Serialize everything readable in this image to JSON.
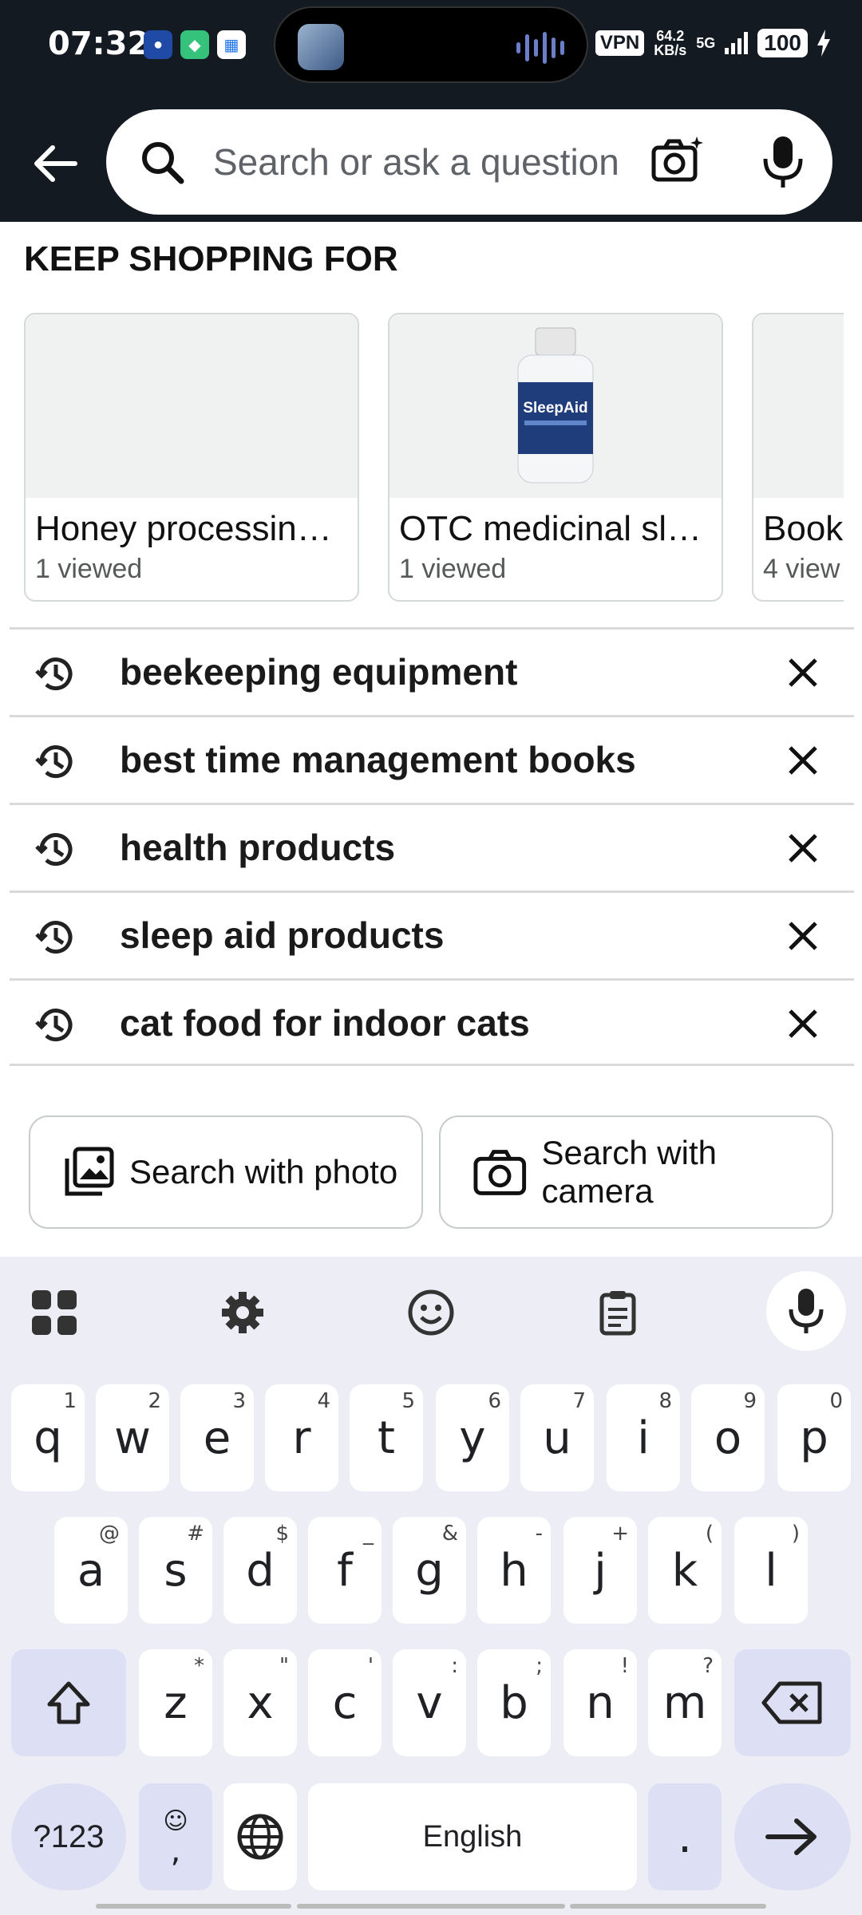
{
  "status_bar": {
    "time": "07:32",
    "vpn": "VPN",
    "net_speed_value": "64.2",
    "net_speed_unit": "KB/s",
    "network": "5G",
    "battery": "100"
  },
  "search": {
    "placeholder": "Search or ask a question"
  },
  "keep_shopping": {
    "title": "KEEP SHOPPING FOR",
    "cards": [
      {
        "name": "Honey processin…",
        "sub": "1 viewed"
      },
      {
        "name": "OTC medicinal sl…",
        "sub": "1 viewed"
      },
      {
        "name": "Book",
        "sub": "4 view"
      }
    ],
    "product_label": "SleepAid"
  },
  "history": [
    "beekeeping equipment",
    "best time management books",
    "health products",
    "sleep aid products",
    "cat food for indoor cats"
  ],
  "buttons": {
    "photo": "Search with photo",
    "camera": "Search with camera"
  },
  "keyboard": {
    "row1": [
      [
        "q",
        "1"
      ],
      [
        "w",
        "2"
      ],
      [
        "e",
        "3"
      ],
      [
        "r",
        "4"
      ],
      [
        "t",
        "5"
      ],
      [
        "y",
        "6"
      ],
      [
        "u",
        "7"
      ],
      [
        "i",
        "8"
      ],
      [
        "o",
        "9"
      ],
      [
        "p",
        "0"
      ]
    ],
    "row2": [
      [
        "a",
        "@"
      ],
      [
        "s",
        "#"
      ],
      [
        "d",
        "$"
      ],
      [
        "f",
        "_"
      ],
      [
        "g",
        "&"
      ],
      [
        "h",
        "-"
      ],
      [
        "j",
        "+"
      ],
      [
        "k",
        "("
      ],
      [
        "l",
        ")"
      ]
    ],
    "row3": [
      [
        "z",
        "*"
      ],
      [
        "x",
        "\""
      ],
      [
        "c",
        "'"
      ],
      [
        "v",
        ":"
      ],
      [
        "b",
        ";"
      ],
      [
        "n",
        "!"
      ],
      [
        "m",
        "?"
      ]
    ],
    "symbols": "?123",
    "comma": ",",
    "space": "English",
    "period": "."
  }
}
